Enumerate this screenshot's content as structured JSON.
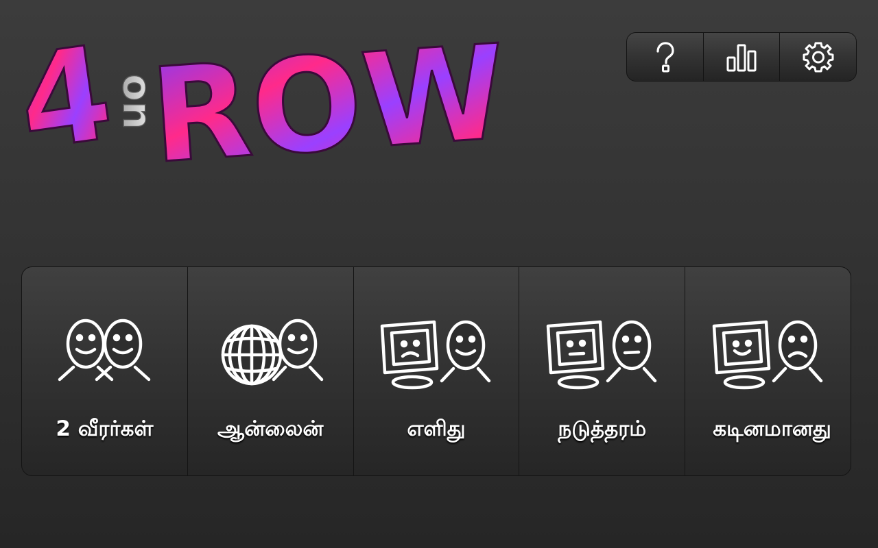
{
  "logo": {
    "main": "4",
    "small": "on",
    "row": "ROW",
    "alt": "4 in a ROW"
  },
  "toolbar": {
    "help": "help",
    "stats": "stats",
    "settings": "settings"
  },
  "modes": [
    {
      "label": "2 வீரர்கள்",
      "icon": "two-players-icon"
    },
    {
      "label": "ஆன்லைன்",
      "icon": "online-globe-icon"
    },
    {
      "label": "எளிது",
      "icon": "computer-easy-icon"
    },
    {
      "label": "நடுத்தரம்",
      "icon": "computer-medium-icon"
    },
    {
      "label": "கடினமானது",
      "icon": "computer-hard-icon"
    }
  ],
  "colors": {
    "pink": "#ff2a8a",
    "purple": "#8a3cff",
    "panel": "#333333",
    "border": "#141414"
  }
}
